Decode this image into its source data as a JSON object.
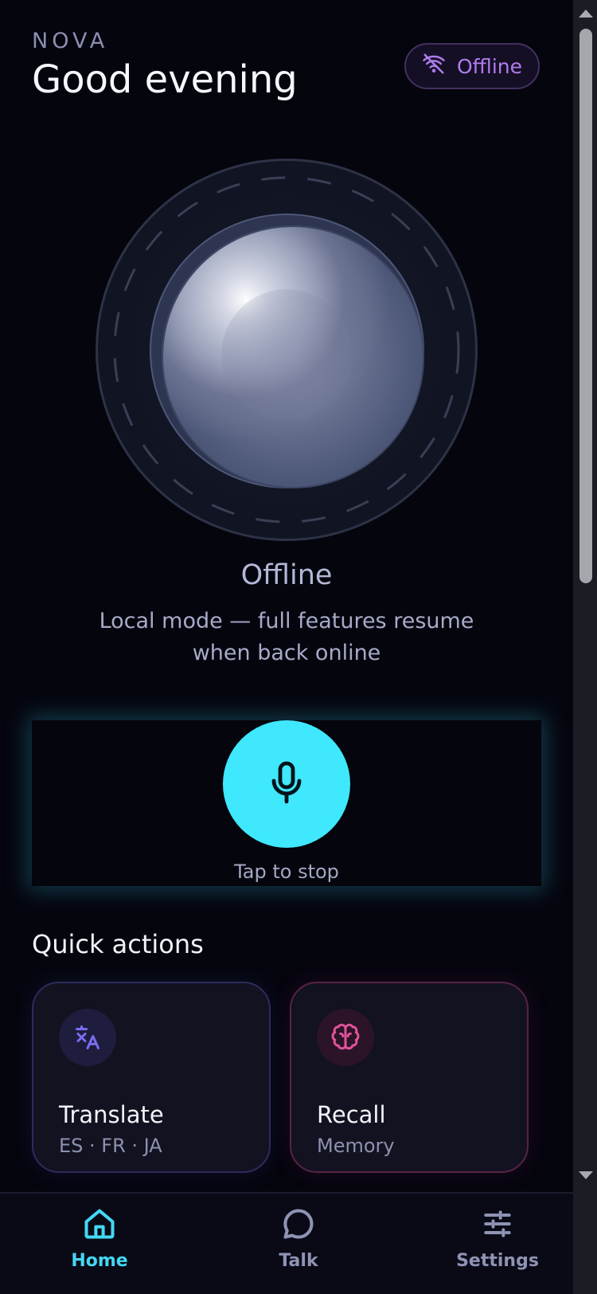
{
  "header": {
    "brand": "NOVA",
    "greeting": "Good evening",
    "status_badge": {
      "label": "Offline",
      "icon": "wifi-off-icon",
      "color": "#b07cec"
    }
  },
  "assistant": {
    "state_title": "Offline",
    "state_description": "Local mode — full features resume when back online"
  },
  "mic": {
    "icon": "microphone-icon",
    "hint": "Tap to stop",
    "accent": "#3fe8fd"
  },
  "quick_actions": {
    "title": "Quick actions",
    "items": [
      {
        "label": "Translate",
        "sub": "ES · FR · JA",
        "icon": "translate-icon",
        "accent": "#7b6cf0"
      },
      {
        "label": "Recall",
        "sub": "Memory",
        "icon": "brain-icon",
        "accent": "#e2539a"
      }
    ]
  },
  "nav": {
    "items": [
      {
        "label": "Home",
        "icon": "home-icon",
        "active": true
      },
      {
        "label": "Talk",
        "icon": "chat-bubble-icon",
        "active": false
      },
      {
        "label": "Settings",
        "icon": "sliders-icon",
        "active": false
      }
    ]
  }
}
